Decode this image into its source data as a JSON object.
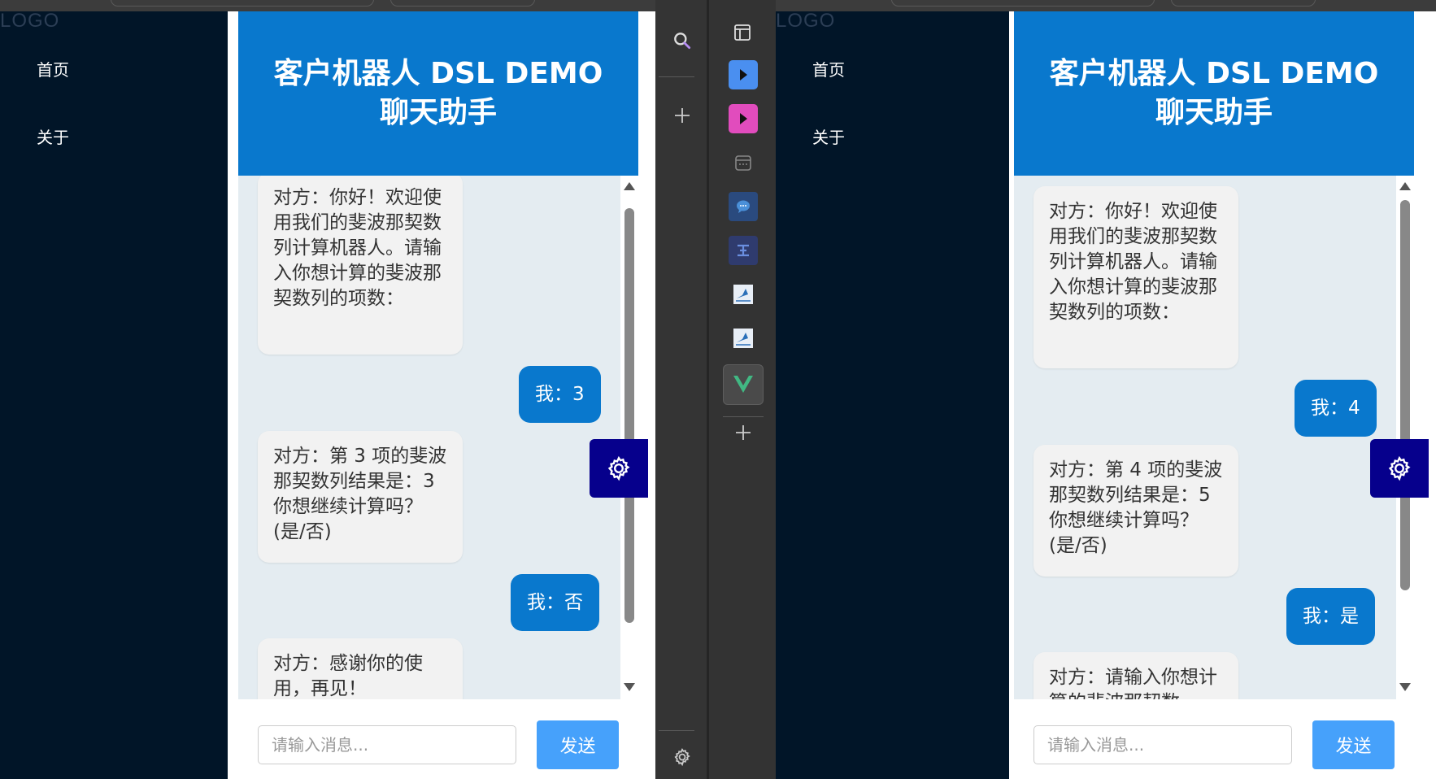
{
  "sidebar": {
    "logo": "LOGO",
    "items": [
      {
        "label": "首页"
      },
      {
        "label": "关于"
      }
    ]
  },
  "chat_left": {
    "title": "客户机器人 DSL DEMO 聊天助手",
    "messages": [
      {
        "role": "bot",
        "text": "对方：你好！欢迎使用我们的斐波那契数列计算机器人。请输入你想计算的斐波那契数列的项数："
      },
      {
        "role": "user",
        "text": "我：3"
      },
      {
        "role": "bot",
        "text": "对方：第 3 项的斐波那契数列结果是：3你想继续计算吗？(是/否)"
      },
      {
        "role": "user",
        "text": "我：否"
      },
      {
        "role": "bot",
        "text": "对方：感谢你的使用，再见！"
      }
    ],
    "input_placeholder": "请输入消息...",
    "send_label": "发送"
  },
  "chat_right": {
    "title": "客户机器人 DSL DEMO 聊天助手",
    "messages": [
      {
        "role": "bot",
        "text": "对方：你好！欢迎使用我们的斐波那契数列计算机器人。请输入你想计算的斐波那契数列的项数："
      },
      {
        "role": "user",
        "text": "我：4"
      },
      {
        "role": "bot",
        "text": "对方：第 4 项的斐波那契数列结果是：5你想继续计算吗？(是/否)"
      },
      {
        "role": "user",
        "text": "我：是"
      },
      {
        "role": "bot",
        "text": "对方：请输入你想计算的斐波那契数"
      }
    ],
    "input_placeholder": "请输入消息...",
    "send_label": "发送"
  },
  "dock": {
    "left": [
      "search-icon",
      "add-icon",
      "settings-icon"
    ],
    "right": [
      "panel-icon",
      "play-blue-icon",
      "play-pink-icon",
      "calendar-icon",
      "chat-bubble-icon",
      "text-tool-icon",
      "kite-app-icon",
      "kite-app-icon",
      "vue-icon",
      "add-icon"
    ]
  },
  "colors": {
    "header": "#0978cd",
    "sidebar": "#011528",
    "chat_bg": "#e4ecf1",
    "send": "#46a1fb",
    "gear_button": "#06008c"
  }
}
